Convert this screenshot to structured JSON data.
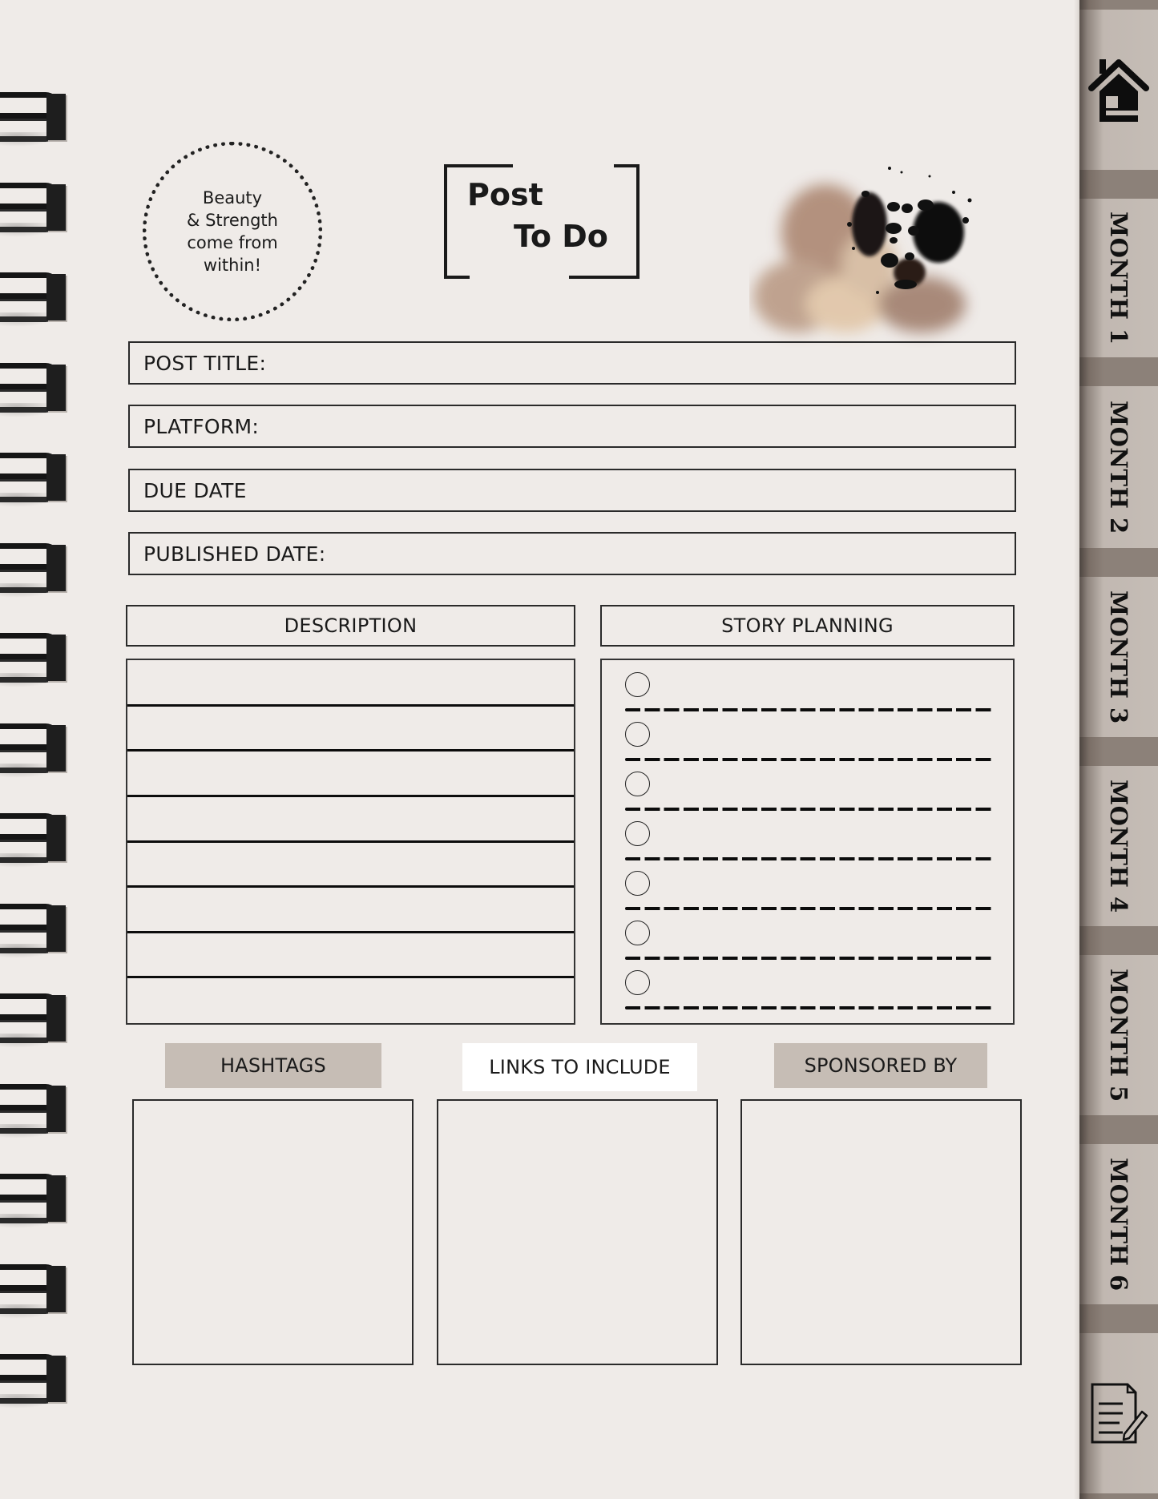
{
  "quote": {
    "lines": [
      "Beauty",
      "& Strength",
      "come from",
      "within!"
    ]
  },
  "title": {
    "line1": "Post",
    "line2": "To Do"
  },
  "fields": [
    {
      "label": "POST TITLE:"
    },
    {
      "label": "PLATFORM:"
    },
    {
      "label": "DUE DATE"
    },
    {
      "label": "PUBLISHED DATE:"
    }
  ],
  "sections": {
    "description": "DESCRIPTION",
    "story_planning": "STORY PLANNING",
    "description_lines": 8,
    "story_checklist_items": 7
  },
  "bottom": {
    "hashtags": "HASHTAGS",
    "links": "LINKS TO INCLUDE",
    "sponsored": "SPONSORED BY"
  },
  "tabs": {
    "home_icon": "home-icon",
    "months": [
      "MONTH 1",
      "MONTH 2",
      "MONTH 3",
      "MONTH 4",
      "MONTH 5",
      "MONTH 6"
    ],
    "notes_icon": "notes-icon"
  },
  "colors": {
    "page": "#efebe8",
    "chip": "#c6bdb5",
    "tab": "#c5bdb6",
    "tab_gap": "#8c8179",
    "ink": "#1a1a1a"
  }
}
